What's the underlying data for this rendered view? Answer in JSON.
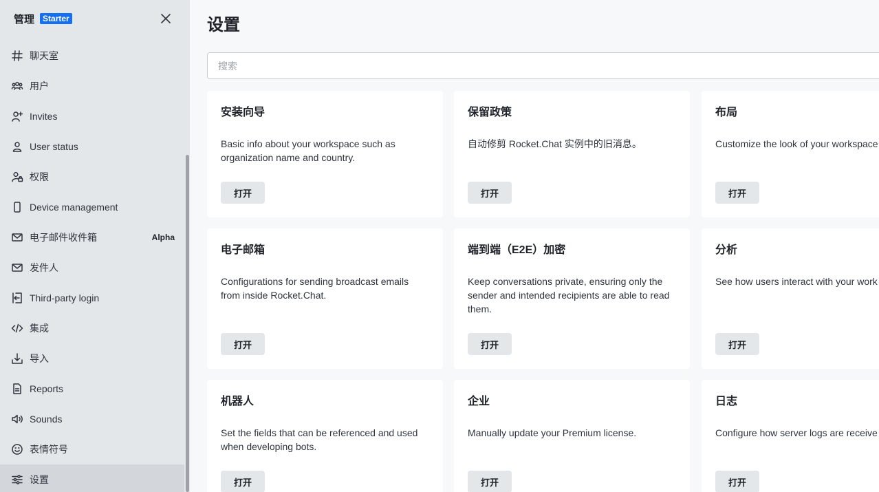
{
  "sidebar": {
    "title": "管理",
    "badge": "Starter",
    "items": [
      {
        "label": "聊天室",
        "icon": "hash-icon"
      },
      {
        "label": "用户",
        "icon": "team-icon"
      },
      {
        "label": "Invites",
        "icon": "user-plus-icon"
      },
      {
        "label": "User status",
        "icon": "user-icon"
      },
      {
        "label": "权限",
        "icon": "user-lock-icon"
      },
      {
        "label": "Device management",
        "icon": "mobile-icon"
      },
      {
        "label": "电子邮件收件箱",
        "icon": "mail-icon",
        "tag": "Alpha"
      },
      {
        "label": "发件人",
        "icon": "mail-outline-icon"
      },
      {
        "label": "Third-party login",
        "icon": "login-icon"
      },
      {
        "label": "集成",
        "icon": "code-icon"
      },
      {
        "label": "导入",
        "icon": "download-icon"
      },
      {
        "label": "Reports",
        "icon": "document-icon"
      },
      {
        "label": "Sounds",
        "icon": "sound-icon"
      },
      {
        "label": "表情符号",
        "icon": "emoji-icon"
      },
      {
        "label": "设置",
        "icon": "customize-icon",
        "active": true
      }
    ]
  },
  "main": {
    "title": "设置",
    "search_placeholder": "搜索",
    "cards": [
      {
        "title": "安装向导",
        "desc": "Basic info about your workspace such as organization name and country.",
        "button": "打开"
      },
      {
        "title": "保留政策",
        "desc": "自动修剪 Rocket.Chat 实例中的旧消息。",
        "button": "打开"
      },
      {
        "title": "布局",
        "desc": "Customize the look of your workspace",
        "button": "打开"
      },
      {
        "title": "电子邮箱",
        "desc": "Configurations for sending broadcast emails from inside Rocket.Chat.",
        "button": "打开"
      },
      {
        "title": "端到端（E2E）加密",
        "desc": "Keep conversations private, ensuring only the sender and intended recipients are able to read them.",
        "button": "打开"
      },
      {
        "title": "分析",
        "desc": "See how users interact with your work",
        "button": "打开"
      },
      {
        "title": "机器人",
        "desc": "Set the fields that can be referenced and used when developing bots.",
        "button": "打开"
      },
      {
        "title": "企业",
        "desc": "Manually update your Premium license.",
        "button": "打开"
      },
      {
        "title": "日志",
        "desc": "Configure how server logs are receive",
        "button": "打开"
      }
    ]
  },
  "colors": {
    "sidebar_bg": "#e4e7ea",
    "active_item_bg": "#d3d7dc",
    "badge_bg": "#156ff5",
    "card_bg": "#ffffff",
    "page_bg": "#f7f8fa"
  }
}
